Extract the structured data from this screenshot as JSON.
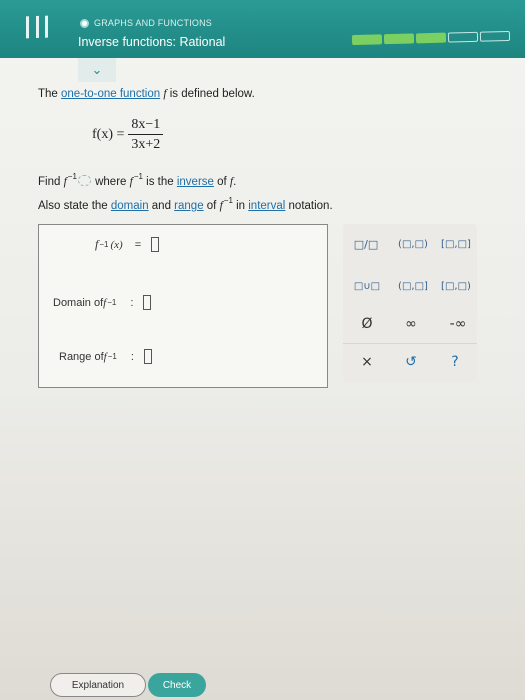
{
  "header": {
    "subject": "GRAPHS AND FUNCTIONS",
    "topic": "Inverse functions: Rational",
    "progress": {
      "completed": 3,
      "total": 5
    }
  },
  "problem": {
    "intro_pre": "The ",
    "intro_link": "one-to-one function",
    "intro_var": "f",
    "intro_post": " is defined below.",
    "func_lhs": "f(x) =",
    "numerator": "8x−1",
    "denominator": "3x+2",
    "find_pre": "Find ",
    "f": "f",
    "inv_exp": "−1",
    "where": " where ",
    "is_the": " is the ",
    "inverse_link": "inverse",
    "of_f_post": " of ",
    "period": ".",
    "also_pre": "Also state the ",
    "domain_link": "domain",
    "and": " and ",
    "range_link": "range",
    "of": " of ",
    "in": " in ",
    "interval_link": "interval",
    "notation": " notation."
  },
  "answer": {
    "inverse_lhs_f": "f",
    "inverse_lhs_exp": "−1",
    "inverse_lhs_arg": "(x)",
    "equals": "=",
    "domain_label": "Domain of ",
    "range_label": "Range of ",
    "colon": ":"
  },
  "palette": {
    "fraction": "□/□",
    "open_open": "(□,□)",
    "closed_closed": "[□,□]",
    "union": "□∪□",
    "open_closed": "(□,□]",
    "closed_open": "[□,□)",
    "empty_set": "Ø",
    "infinity": "∞",
    "neg_infinity": "-∞",
    "clear": "×",
    "undo": "↺",
    "help": "?"
  },
  "footer": {
    "explanation": "Explanation",
    "check": "Check"
  }
}
